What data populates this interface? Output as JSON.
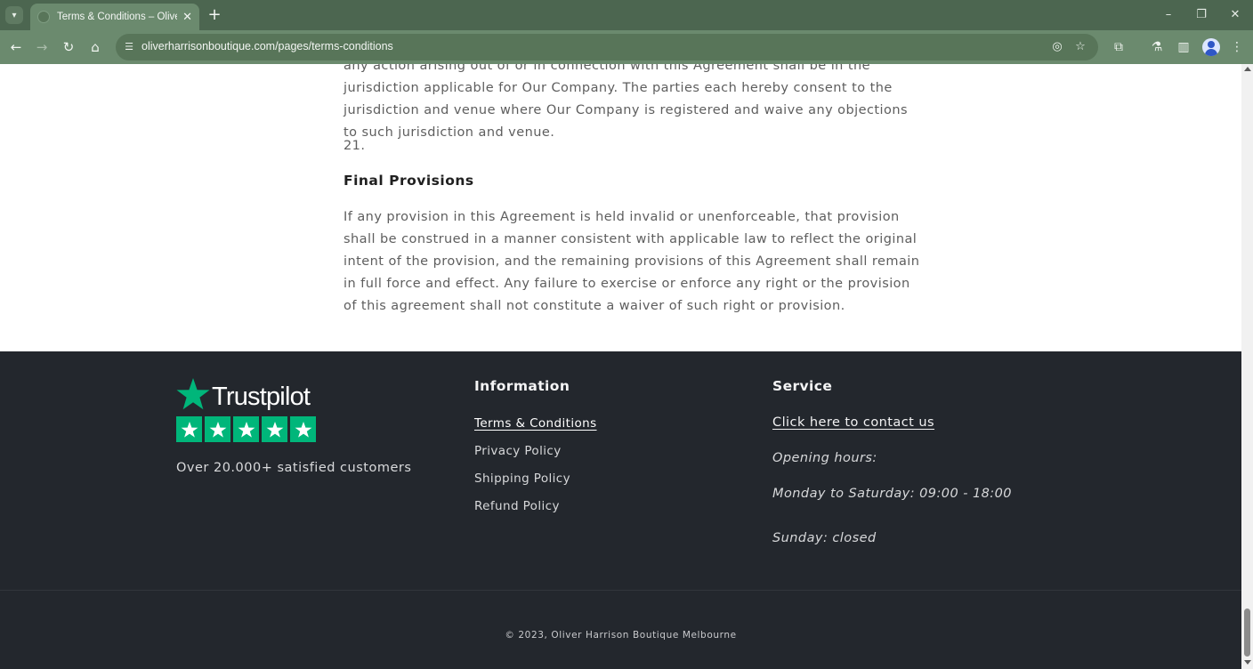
{
  "browser": {
    "tab_title": "Terms & Conditions – Oliver Harrison Boutique",
    "tab_close": "✕",
    "new_tab": "+",
    "url": "oliverharrisonboutique.com/pages/terms-conditions",
    "icons": {
      "tab_list": "chevron-down-icon",
      "back": "arrow-left-icon",
      "forward": "arrow-right-icon",
      "reload": "reload-icon",
      "home": "home-icon",
      "site_info": "tune-icon",
      "eye_off": "eye-off-icon",
      "bookmark": "star-icon",
      "extensions": "puzzle-icon",
      "labs": "flask-icon",
      "side_panel": "side-panel-icon",
      "profile": "profile-icon",
      "menu": "kebab-menu-icon"
    }
  },
  "article": {
    "intro_paragraph": "any action arising out of or in connection with this Agreement shall be in the jurisdiction applicable for Our Company. The parties each hereby consent to the jurisdiction and venue where Our Company is registered and waive any objections to such jurisdiction and venue.",
    "section_number": "21.",
    "section_title": "Final Provisions",
    "section_body": "If any provision in this Agreement is held invalid or unenforceable, that provision shall be construed in a manner consistent with applicable law to reflect the original intent of the provision, and the remaining provisions of this Agreement shall remain in full force and effect. Any failure to exercise or enforce any right or the provision of this agreement shall not constitute a waiver of such right or provision."
  },
  "footer": {
    "trustpilot": {
      "logo_text": "Trustpilot",
      "rating_stars": 5,
      "tagline": "Over 20.000+ satisfied customers"
    },
    "information": {
      "heading": "Information",
      "links": [
        "Terms & Conditions",
        "Privacy Policy",
        "Shipping Policy",
        "Refund Policy"
      ]
    },
    "service": {
      "heading": "Service",
      "contact_link": "Click here to contact us",
      "opening_hours_label": "Opening hours:",
      "weekday_hours": "Monday to Saturday: 09:00 - 18:00",
      "sunday_hours": "Sunday: closed"
    },
    "copyright": "© 2023, Oliver Harrison Boutique Melbourne"
  },
  "colors": {
    "tabbar": "#4c6650",
    "toolbar": "#6b8a6e",
    "footer_bg": "#23272d",
    "trustpilot_green": "#00b67a"
  }
}
